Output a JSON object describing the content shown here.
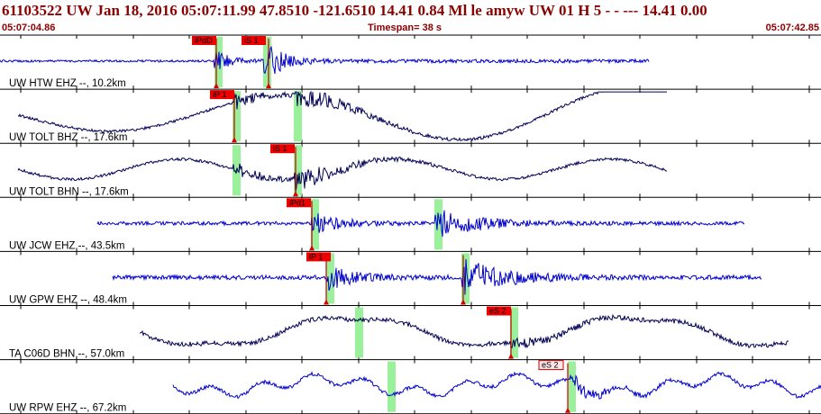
{
  "header": {
    "title": "61103522 UW Jan 18, 2016 05:07:11.99    47.8510 -121.6510 14.41 0.84 Ml le    amyw    UW 01 H    5  -  - --- 14.41 0.00",
    "start_time": "05:07:04.86",
    "timespan": "Timespan=  38 s",
    "end_time": "05:07:42.85"
  },
  "traces": [
    {
      "label": "UW HTW EHZ --, 10.2km",
      "color": "#0000cc",
      "picks": [
        {
          "label": "iPdD",
          "style": "red"
        },
        {
          "label": "iS 1",
          "style": "red"
        }
      ]
    },
    {
      "label": "UW TOLT BHZ --, 17.6km",
      "color": "#000055",
      "picks": [
        {
          "label": "iP 1",
          "style": "red"
        }
      ]
    },
    {
      "label": "UW TOLT BHN --, 17.6km",
      "color": "#000055",
      "picks": [
        {
          "label": "iS 1",
          "style": "red"
        }
      ]
    },
    {
      "label": "UW JCW EHZ --, 43.5km",
      "color": "#0000cc",
      "picks": [
        {
          "label": "iPd1",
          "style": "red"
        }
      ]
    },
    {
      "label": "UW GPW EHZ --, 48.4km",
      "color": "#0000cc",
      "picks": [
        {
          "label": "iP 1",
          "style": "red"
        }
      ]
    },
    {
      "label": "TA C06D BHN --, 57.0km",
      "color": "#000055",
      "picks": [
        {
          "label": "eS 2",
          "style": "red"
        }
      ]
    },
    {
      "label": "UW RPW EHZ --, 67.2km",
      "color": "#0000cc",
      "picks": [
        {
          "label": "eS 2",
          "style": "outline"
        }
      ]
    }
  ]
}
